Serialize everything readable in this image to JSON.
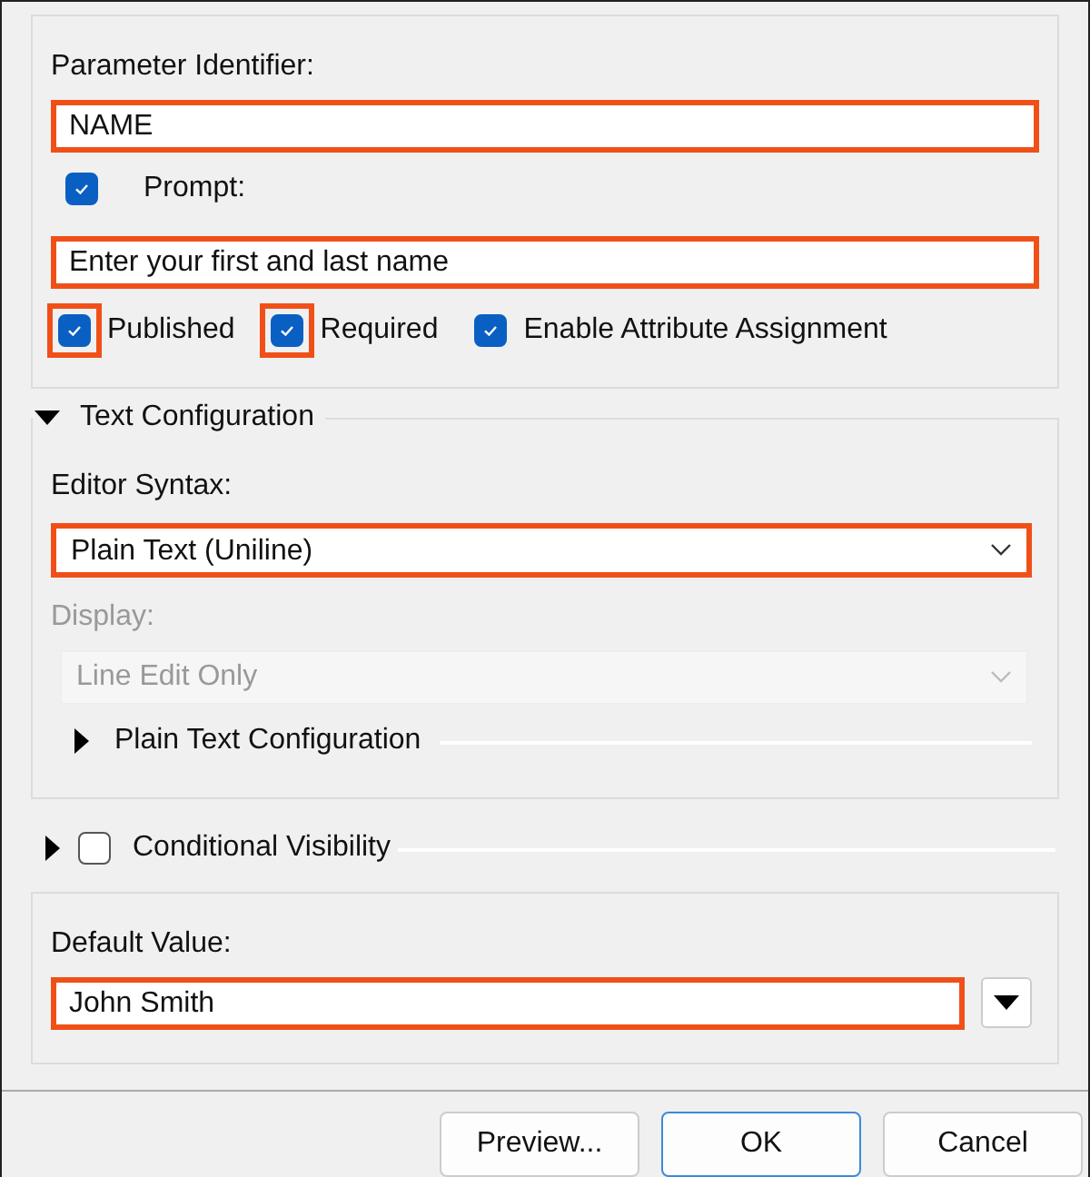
{
  "identifier": {
    "label": "Parameter Identifier:",
    "value": "NAME",
    "highlighted": true
  },
  "prompt": {
    "label": "Prompt:",
    "checked": true,
    "value": "Enter your first and last name",
    "highlighted": true
  },
  "options": [
    {
      "label": "Published",
      "checked": true,
      "highlighted": true
    },
    {
      "label": "Required",
      "checked": true,
      "highlighted": true
    },
    {
      "label": "Enable Attribute Assignment",
      "checked": true,
      "highlighted": false
    }
  ],
  "text_configuration": {
    "title": "Text Configuration",
    "expanded": true,
    "editor_syntax": {
      "label": "Editor Syntax:",
      "value": "Plain Text (Uniline)",
      "highlighted": true,
      "disabled": false
    },
    "display": {
      "label": "Display:",
      "value": "Line Edit Only",
      "highlighted": false,
      "disabled": true
    },
    "sub_section": {
      "title": "Plain Text Configuration",
      "expanded": false
    }
  },
  "conditional_visibility": {
    "title": "Conditional Visibility",
    "expanded": false,
    "checked": false
  },
  "default_value": {
    "label": "Default Value:",
    "value": "John Smith",
    "highlighted": true
  },
  "buttons": [
    {
      "label": "Preview...",
      "default": false
    },
    {
      "label": "OK",
      "default": true
    },
    {
      "label": "Cancel",
      "default": false
    }
  ]
}
